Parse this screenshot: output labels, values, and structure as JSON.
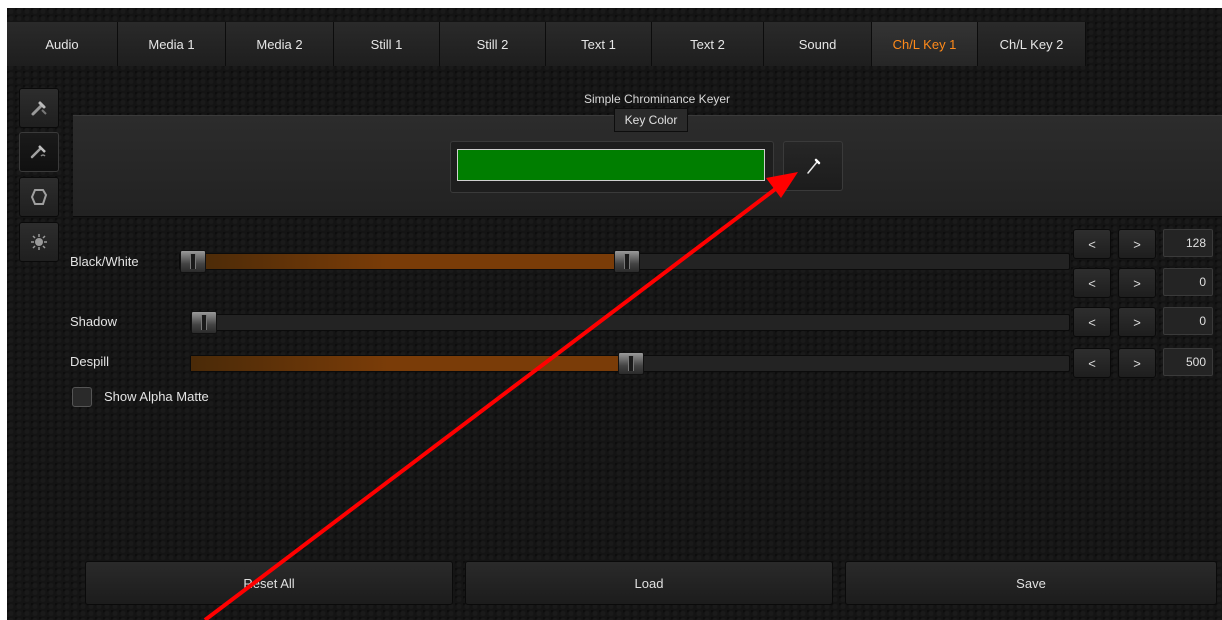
{
  "tabs": [
    {
      "label": "Audio"
    },
    {
      "label": "Media 1"
    },
    {
      "label": "Media 2"
    },
    {
      "label": "Still 1"
    },
    {
      "label": "Still 2"
    },
    {
      "label": "Text 1"
    },
    {
      "label": "Text 2"
    },
    {
      "label": "Sound"
    },
    {
      "label": "Ch/L Key 1",
      "active": true
    },
    {
      "label": "Ch/L Key 2"
    }
  ],
  "sidebar": {
    "items": [
      {
        "icon": "eyedropper-cross-icon"
      },
      {
        "icon": "eyedropper-scribble-icon",
        "active": true
      },
      {
        "icon": "frame-icon"
      },
      {
        "icon": "splash-icon"
      }
    ]
  },
  "keyer": {
    "title": "Simple Chrominance Keyer",
    "key_color_label": "Key Color",
    "key_color": "#007e00",
    "picker_icon": "eyedropper-icon"
  },
  "controls": {
    "black_white": {
      "label": "Black/White",
      "low": 0,
      "high": 128
    },
    "shadow": {
      "label": "Shadow",
      "value": 0
    },
    "despill": {
      "label": "Despill",
      "value": 500
    },
    "show_alpha_matte": {
      "label": "Show Alpha Matte",
      "checked": false
    },
    "dec_label": "<",
    "inc_label": ">"
  },
  "buttons": {
    "reset_all": "Reset All",
    "load": "Load",
    "save": "Save"
  },
  "accent": "#ff8a1a",
  "annotation_color": "#ff0000"
}
